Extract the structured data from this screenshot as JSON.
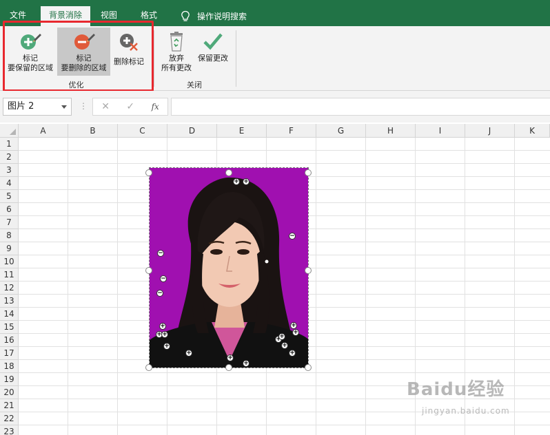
{
  "tabs": [
    {
      "label": "文件"
    },
    {
      "label": "背景消除"
    },
    {
      "label": "视图"
    },
    {
      "label": "格式"
    }
  ],
  "search_label": "操作说明搜索",
  "ribbon": {
    "mark_keep": {
      "line1": "标记",
      "line2": "要保留的区域"
    },
    "mark_remove": {
      "line1": "标记",
      "line2": "要删除的区域"
    },
    "delete_mark": "删除标记",
    "discard": {
      "line1": "放弃",
      "line2": "所有更改"
    },
    "keep_changes": "保留更改",
    "group_refine": "优化",
    "group_close": "关闭"
  },
  "formula_bar": {
    "name_box": "图片 2",
    "cancel": "✕",
    "enter": "✓",
    "fx": "fx",
    "value": ""
  },
  "columns": [
    "A",
    "B",
    "C",
    "D",
    "E",
    "F",
    "G",
    "H",
    "I",
    "J",
    "K"
  ],
  "rows": [
    "1",
    "2",
    "3",
    "4",
    "5",
    "6",
    "7",
    "8",
    "9",
    "10",
    "11",
    "12",
    "13",
    "14",
    "15",
    "16",
    "17",
    "18",
    "19",
    "20",
    "21",
    "22",
    "23"
  ],
  "colors": {
    "excel_green": "#217346",
    "background_removal": "#a010b0",
    "highlight_box": "#e8282e"
  },
  "watermark": {
    "main": "Baidu经验",
    "sub": "jingyan.baidu.com"
  }
}
